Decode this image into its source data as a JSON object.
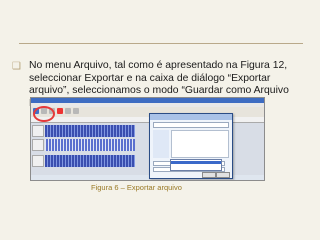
{
  "slide": {
    "paragraph": "No menu Arquivo, tal como é apresentado na Figura 12, seleccionar Exportar e na caixa de diálogo “Exportar arquivo”, seleccionamos o modo “Guardar como Arquivo MP3”.",
    "caption": "Figura 6 – Exportar arquivo",
    "colors": {
      "background": "#f4f2e9",
      "rule": "#b9a98a",
      "bullet": "#b6a37a",
      "caption": "#9a7a27",
      "highlight_circle": "#e53939"
    }
  }
}
